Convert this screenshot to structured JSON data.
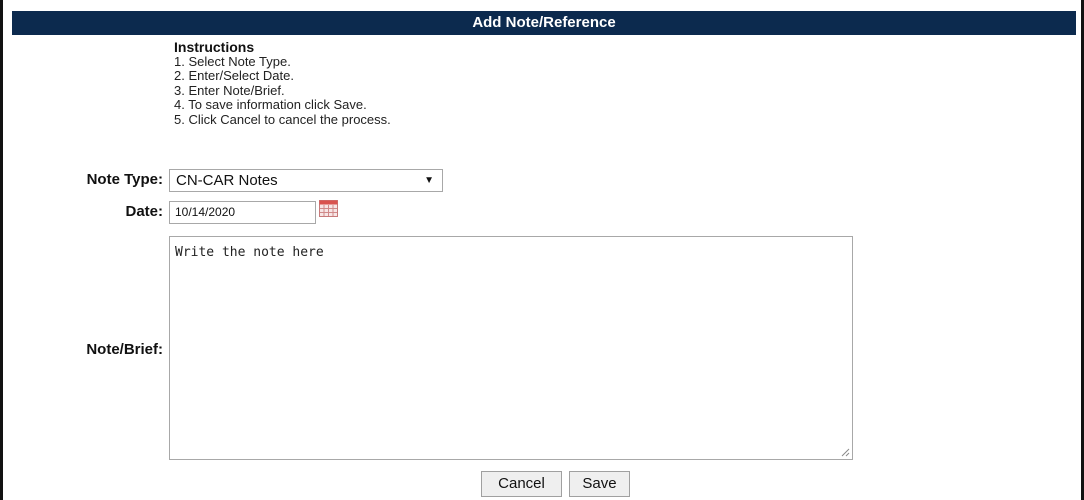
{
  "dialog": {
    "title": "Add Note/Reference"
  },
  "instructions": {
    "heading": "Instructions",
    "steps": [
      "1. Select Note Type.",
      "2. Enter/Select Date.",
      "3. Enter Note/Brief.",
      "4. To save information click Save.",
      "5. Click Cancel to cancel the process."
    ]
  },
  "form": {
    "note_type": {
      "label": "Note Type:",
      "value": "CN-CAR Notes",
      "arrow": "▼"
    },
    "date": {
      "label": "Date:",
      "value": "10/14/2020",
      "icon": "calendar-icon"
    },
    "note_brief": {
      "label": "Note/Brief:",
      "value": "Write the note here"
    }
  },
  "buttons": {
    "cancel": "Cancel",
    "save": "Save"
  },
  "colors": {
    "title_bar": "#0c2a4e",
    "title_text": "#ffffff",
    "calendar_accent": "#c0392b"
  }
}
